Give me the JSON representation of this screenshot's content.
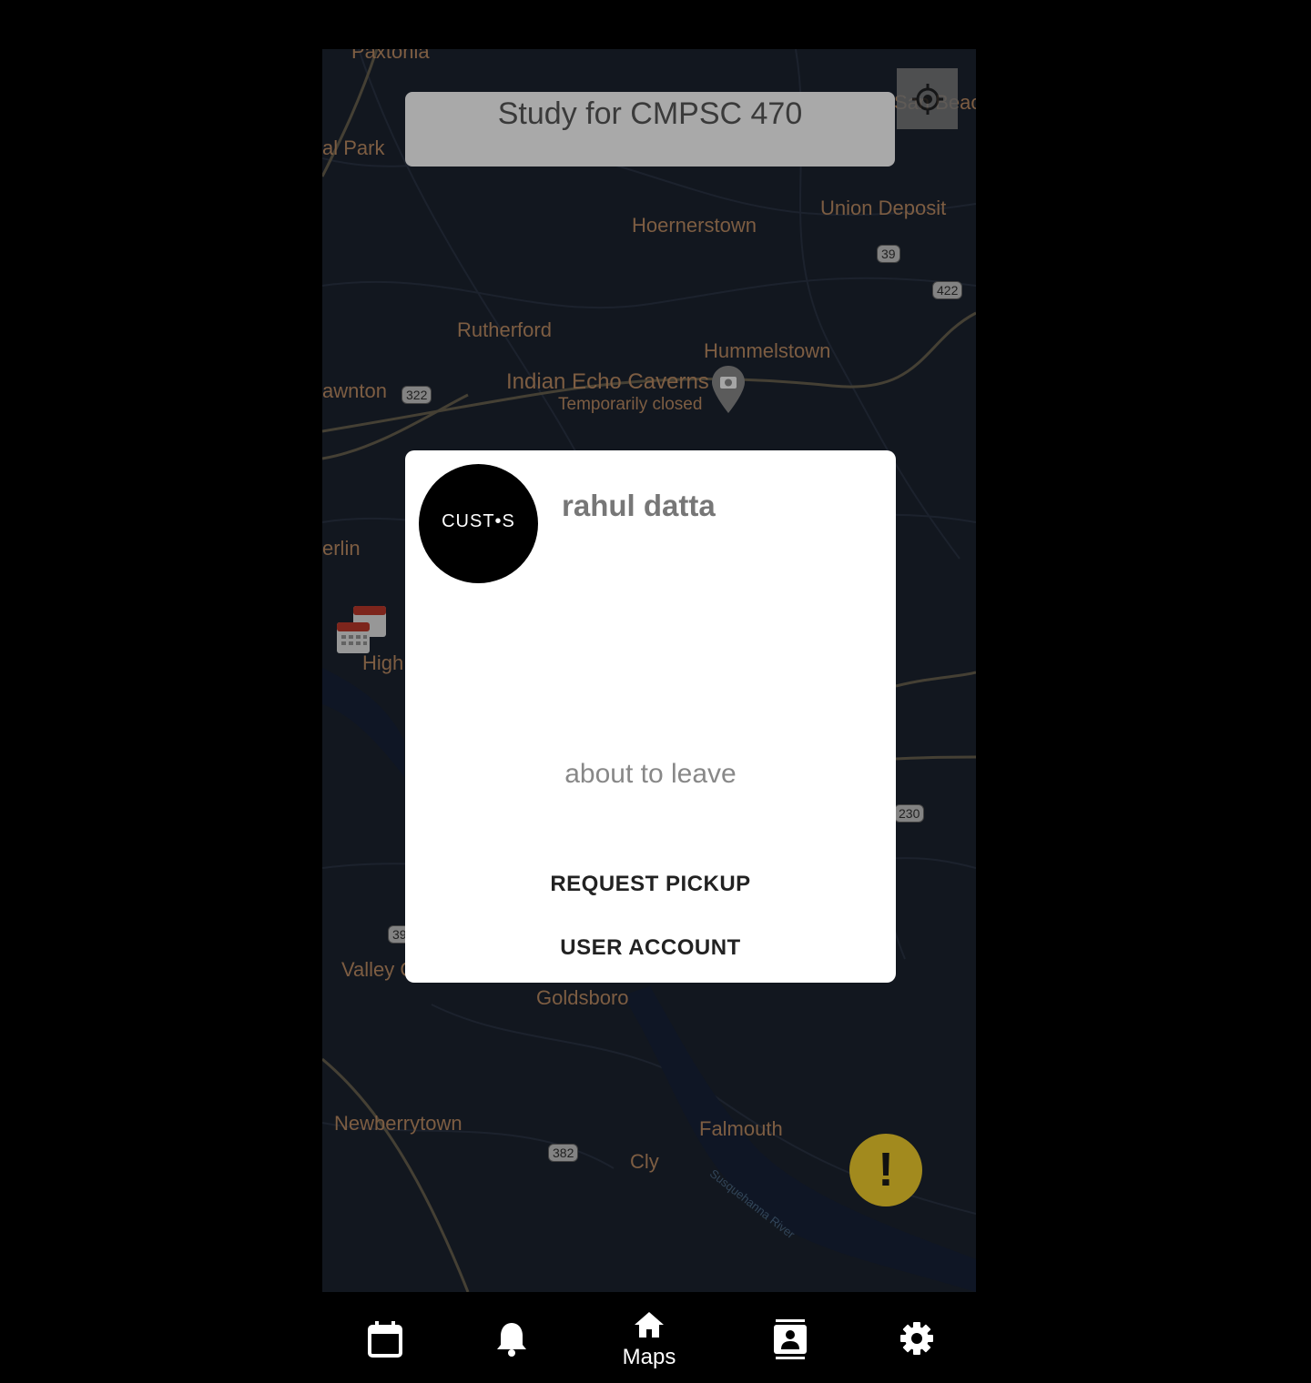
{
  "map": {
    "places": [
      "Paxtonia",
      "al Park",
      "Union Deposit",
      "Hoernerstown",
      "Rutherford",
      "Hummelstown",
      "Indian Echo Caverns",
      "Temporarily closed",
      "awnton",
      "erlin",
      "High",
      "Valley G",
      "Goldsboro",
      "Newberrytown",
      "Falmouth",
      "Cly",
      "San Beac"
    ],
    "river": "Susquehanna River",
    "shields": [
      "39",
      "422",
      "322",
      "230",
      "39",
      "382"
    ]
  },
  "search": {
    "text": "Study for CMPSC 470"
  },
  "dialog": {
    "avatar_text": "CUST•S",
    "name": "rahul datta",
    "status": "about to leave",
    "request_pickup": "REQUEST PICKUP",
    "user_account": "USER ACCOUNT"
  },
  "fab": {
    "symbol": "!"
  },
  "nav": {
    "items": [
      {
        "icon": "calendar-icon"
      },
      {
        "icon": "bell-icon"
      },
      {
        "icon": "home-icon",
        "label": "Maps"
      },
      {
        "icon": "contacts-icon"
      },
      {
        "icon": "gear-icon"
      }
    ]
  },
  "colors": {
    "map_bg": "#1c2431",
    "label": "#c08f66",
    "fab": "#a28a1e",
    "dialog": "#ffffff"
  }
}
